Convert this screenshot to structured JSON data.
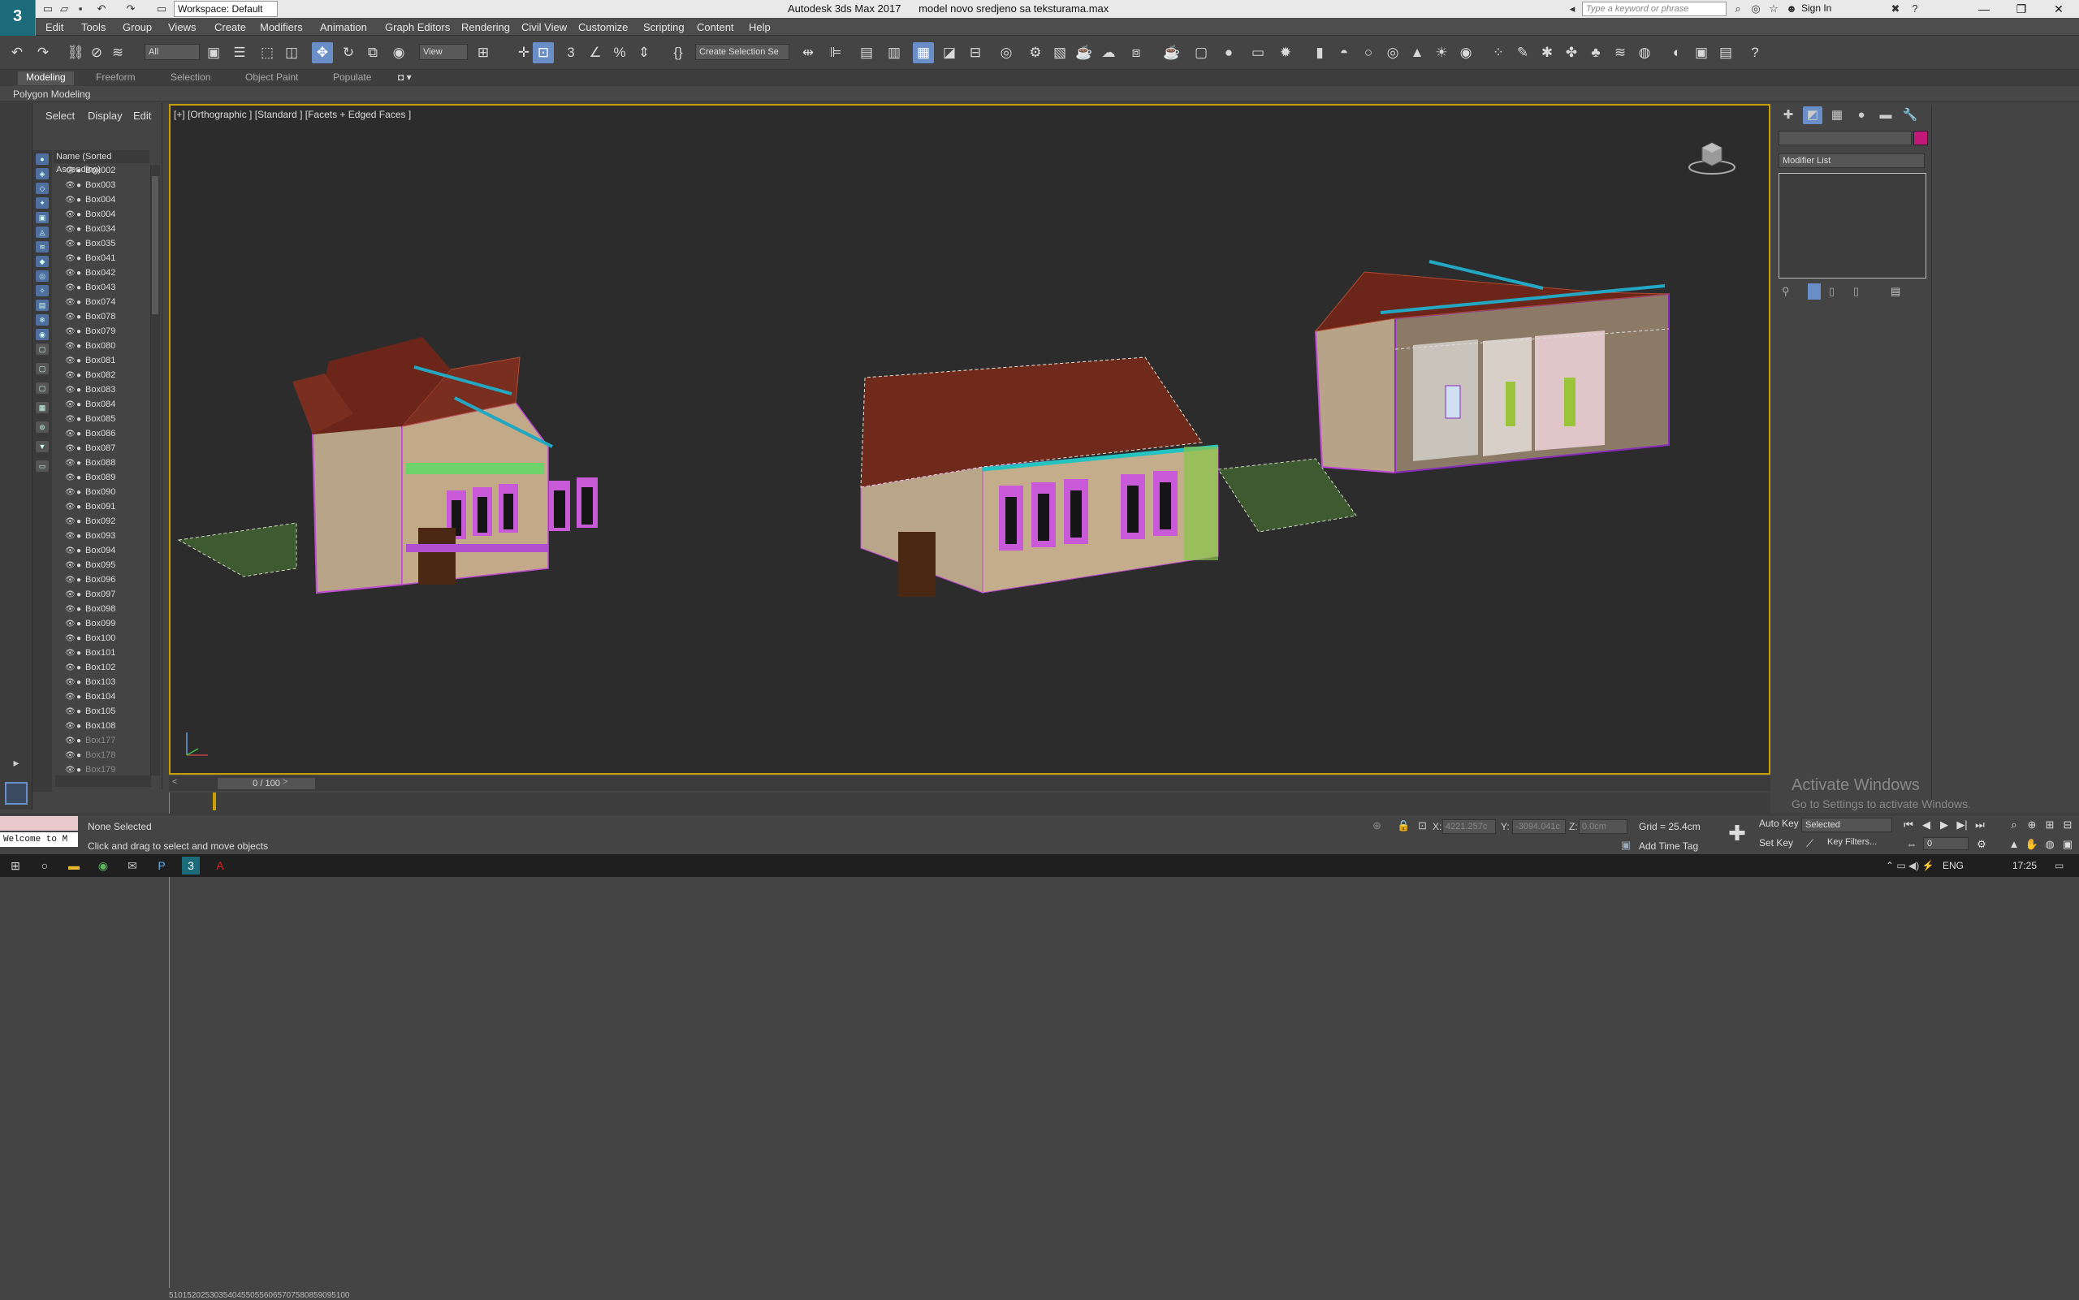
{
  "titlebar": {
    "logo": "3",
    "workspace": "Workspace: Default",
    "title": "Autodesk 3ds Max 2017      model novo sredjeno sa teksturama.max",
    "search_placeholder": "Type a keyword or phrase",
    "sign_in": "Sign In"
  },
  "menu": [
    "Edit",
    "Tools",
    "Group",
    "Views",
    "Create",
    "Modifiers",
    "Animation",
    "Graph Editors",
    "Rendering",
    "Civil View",
    "Customize",
    "Scripting",
    "Content",
    "Help"
  ],
  "toolbar": {
    "filter": "All",
    "refcoord": "View",
    "selection_set": "Create Selection Se"
  },
  "ribbon": {
    "tabs": [
      "Modeling",
      "Freeform",
      "Selection",
      "Object Paint",
      "Populate"
    ],
    "active_tab": "Modeling",
    "panel_label": "Polygon Modeling"
  },
  "explorer": {
    "tabs": [
      "Select",
      "Display",
      "Edit"
    ],
    "column_header": "Name (Sorted Ascending)",
    "items": [
      "Box002",
      "Box003",
      "Box004",
      "Box004",
      "Box034",
      "Box035",
      "Box041",
      "Box042",
      "Box043",
      "Box074",
      "Box078",
      "Box079",
      "Box080",
      "Box081",
      "Box082",
      "Box083",
      "Box084",
      "Box085",
      "Box086",
      "Box087",
      "Box088",
      "Box089",
      "Box090",
      "Box091",
      "Box092",
      "Box093",
      "Box094",
      "Box095",
      "Box096",
      "Box097",
      "Box098",
      "Box099",
      "Box100",
      "Box101",
      "Box102",
      "Box103",
      "Box104",
      "Box105",
      "Box108"
    ],
    "dim_items": [
      "Box177",
      "Box178",
      "Box179"
    ]
  },
  "viewport": {
    "label": "[+] [Orthographic ] [Standard ] [Facets + Edged Faces ]"
  },
  "command_panel": {
    "modifier_list": "Modifier List",
    "activate_title": "Activate Windows",
    "activate_sub": "Go to Settings to activate Windows."
  },
  "timeline": {
    "slider_text": "0 / 100",
    "ticks": [
      "5",
      "10",
      "15",
      "20",
      "25",
      "30",
      "35",
      "40",
      "45",
      "50",
      "55",
      "60",
      "65",
      "70",
      "75",
      "80",
      "85",
      "90",
      "95",
      "100"
    ]
  },
  "status": {
    "maxscript": "Welcome to M",
    "selection": "None Selected",
    "prompt": "Click and drag to select and move objects",
    "x_label": "X:",
    "x_value": "4221.257c",
    "y_label": "Y:",
    "y_value": "-3094.041c",
    "z_label": "Z:",
    "z_value": "0.0cm",
    "grid": "Grid = 25.4cm",
    "add_time_tag": "Add Time Tag",
    "auto_key": "Auto Key",
    "selected": "Selected",
    "set_key": "Set Key",
    "key_filters": "Key Filters...",
    "frame": "0"
  },
  "taskbar": {
    "tray": "ENG",
    "clock": "17:25"
  },
  "colors": {
    "viewport_border": "#c8a000",
    "selection_accent": "#6a8ec7",
    "object_color": "#c2187a"
  }
}
